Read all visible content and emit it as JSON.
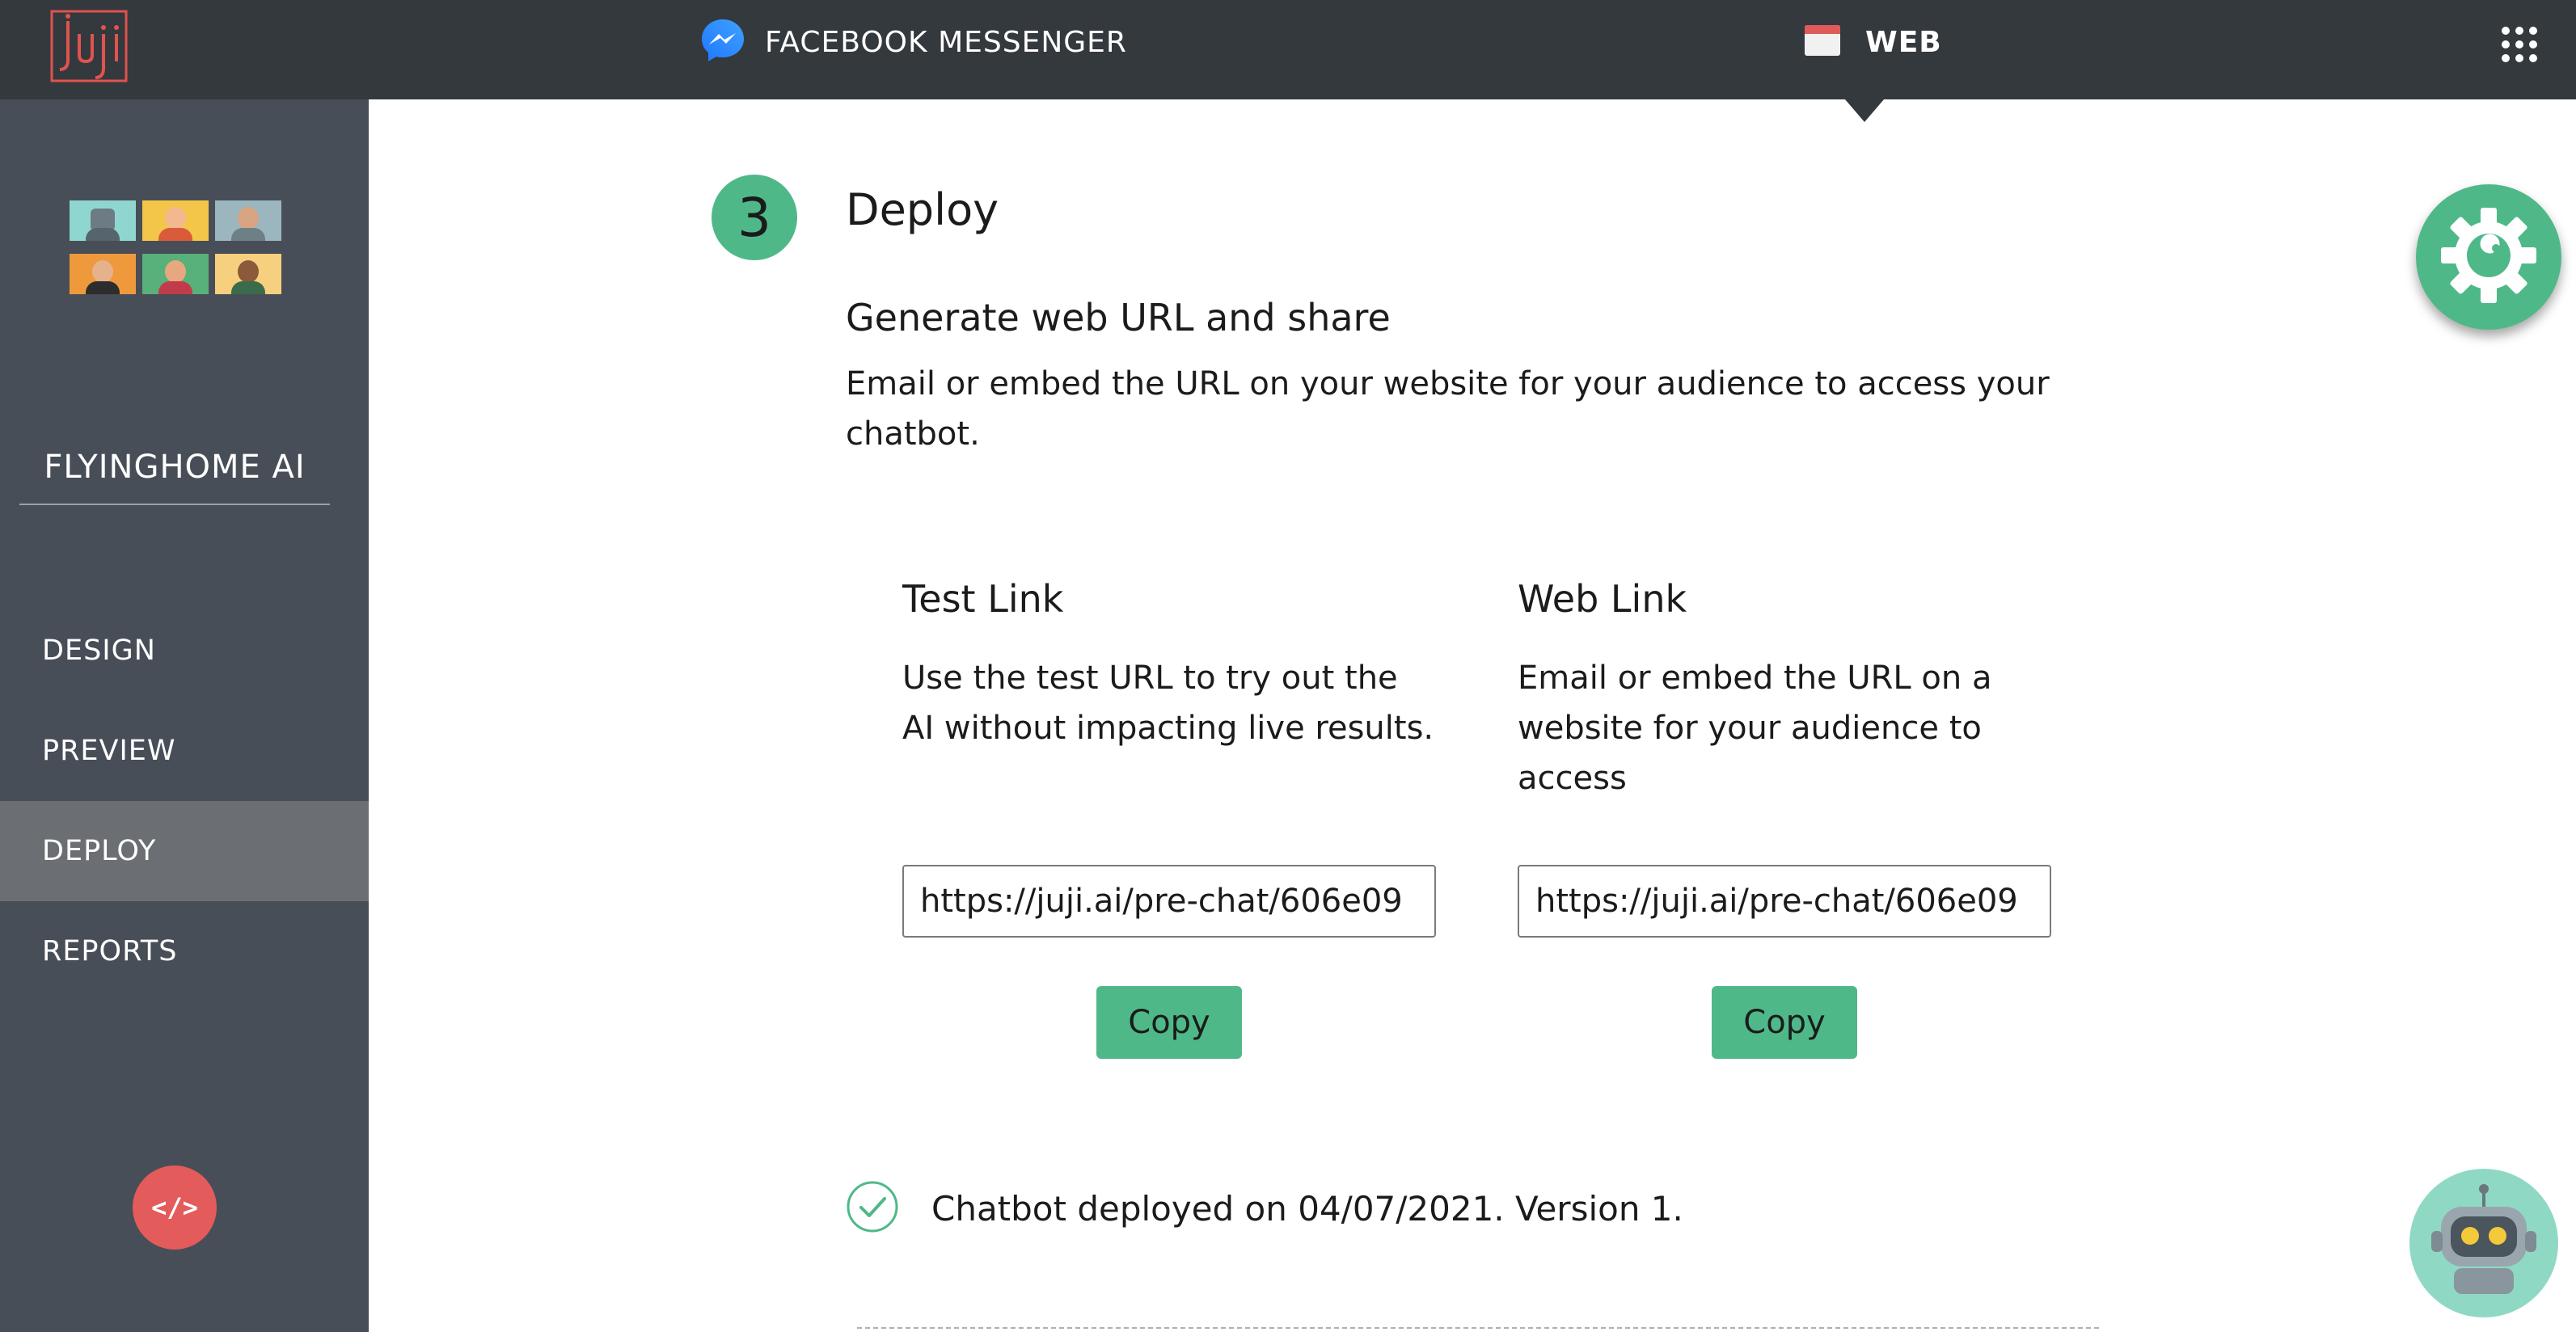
{
  "header": {
    "channels": [
      {
        "label": "FACEBOOK MESSENGER",
        "icon": "messenger-icon"
      },
      {
        "label": "WEB",
        "icon": "browser-window-icon",
        "active": true
      }
    ],
    "logo_icon": "juji-logo",
    "apps_icon": "apps-grid-icon"
  },
  "sidebar": {
    "bot_name": "FLYINGHOME AI",
    "avatar_icons": [
      "robot-avatar",
      "person-avatar",
      "person-avatar",
      "person-avatar",
      "person-avatar",
      "person-avatar"
    ],
    "nav": [
      {
        "label": "DESIGN"
      },
      {
        "label": "PREVIEW"
      },
      {
        "label": "DEPLOY",
        "active": true
      },
      {
        "label": "REPORTS"
      }
    ],
    "code_button_label": "</>"
  },
  "main": {
    "step_number": "3",
    "step_title": "Deploy",
    "section_title": "Generate web URL and share",
    "section_desc": "Email or embed the URL on your website for your audience to access your chatbot.",
    "test_link": {
      "title": "Test Link",
      "desc": "Use the test URL to try out the AI without impacting live results.",
      "url": "https://juji.ai/pre-chat/606e09",
      "copy_label": "Copy"
    },
    "web_link": {
      "title": "Web Link",
      "desc": "Email or embed the URL on a website for your audience to access",
      "url": "https://juji.ai/pre-chat/606e09",
      "copy_label": "Copy"
    },
    "status_text": "Chatbot deployed on 04/07/2021. Version 1.",
    "status_icon": "check-circle-icon"
  },
  "floating": {
    "settings_icon": "gear-wrench-icon",
    "assistant_icon": "robot-icon"
  },
  "colors": {
    "topbar": "#34393e",
    "sidebar": "#484e57",
    "sidebar_active": "#6b6e72",
    "accent_green": "#4fb889",
    "code_button": "#e45b5b",
    "logo_red": "#e0534f"
  }
}
